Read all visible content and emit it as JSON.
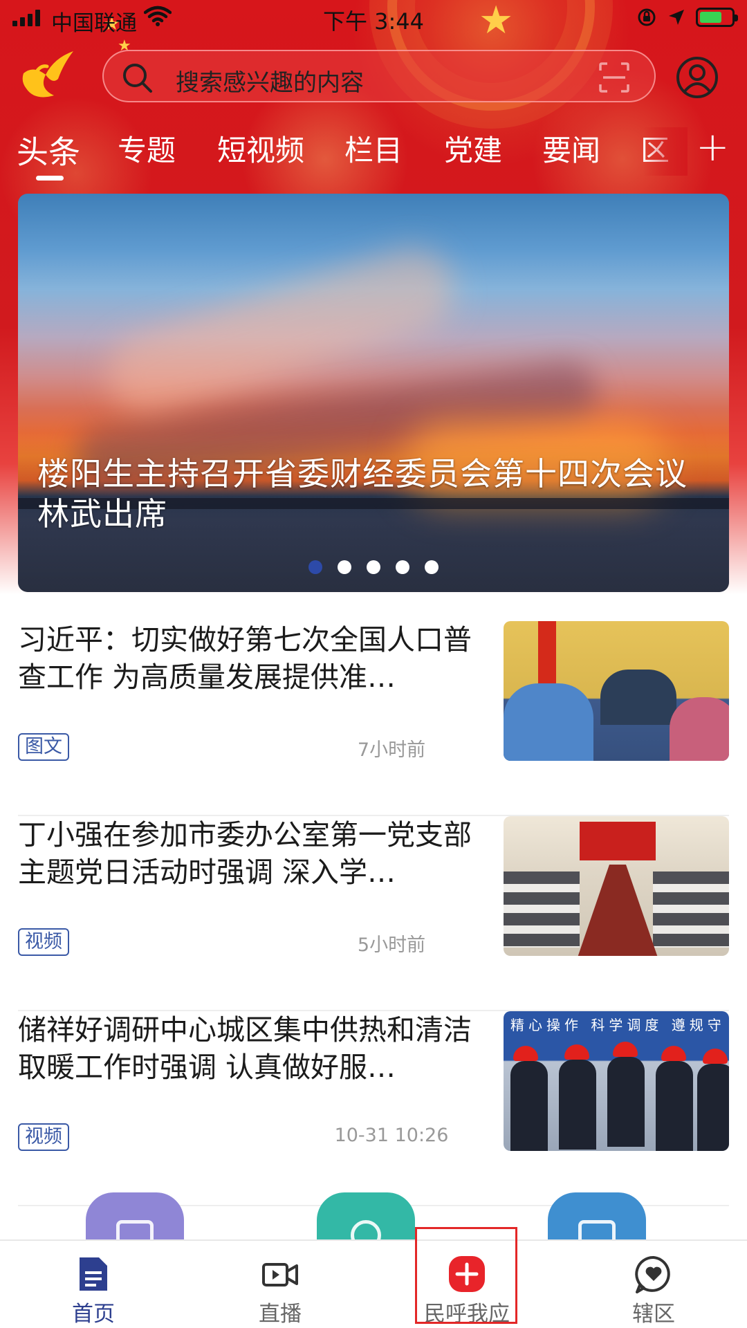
{
  "status_bar": {
    "carrier": "中国联通",
    "time": "下午 3:44"
  },
  "search": {
    "placeholder": "搜索感兴趣的内容"
  },
  "tabs": [
    {
      "label": "头条",
      "active": true
    },
    {
      "label": "专题"
    },
    {
      "label": "短视频"
    },
    {
      "label": "栏目"
    },
    {
      "label": "党建"
    },
    {
      "label": "要闻"
    },
    {
      "label": "区"
    }
  ],
  "add_channel_label": "+",
  "banner": {
    "title": "楼阳生主持召开省委财经委员会第十四次会议  林武出席",
    "slide_count": 5,
    "active_slide": 1
  },
  "news": [
    {
      "title": "习近平：切实做好第七次全国人口普查工作 为高质量发展提供准…",
      "tag": "图文",
      "time": "7小时前"
    },
    {
      "title": "丁小强在参加市委办公室第一党支部主题党日活动时强调 深入学…",
      "tag": "视频",
      "time": "5小时前"
    },
    {
      "title": "储祥好调研中心城区集中供热和清洁取暖工作时强调 认真做好服…",
      "tag": "视频",
      "time": "10-31 10:26"
    }
  ],
  "thumb3_text": "精心操作  科学调度  遵规守纪",
  "bottom_nav": [
    {
      "label": "首页",
      "icon": "document-icon",
      "active": true
    },
    {
      "label": "直播",
      "icon": "video-camera-icon"
    },
    {
      "label": "民呼我应",
      "icon": "plus-circle-icon"
    },
    {
      "label": "辖区",
      "icon": "heart-chat-icon"
    }
  ],
  "colors": {
    "header_red": "#d7161b",
    "accent_blue": "#2d3f8f",
    "tag_blue": "#3a59a6",
    "cta_red": "#e8242a"
  }
}
